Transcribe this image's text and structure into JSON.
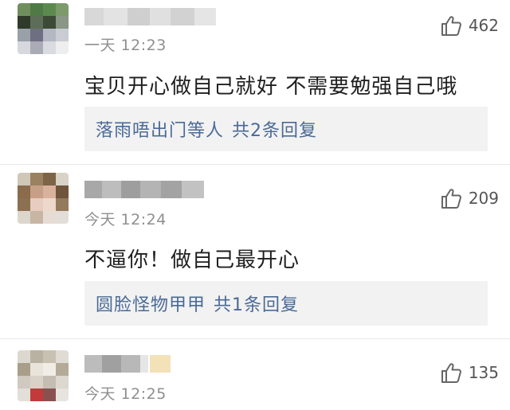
{
  "comments": [
    {
      "time": "一天 12:23",
      "likes": "462",
      "content": "宝贝开心做自己就好 不需要勉强自己哦",
      "reply_user": "落雨唔出门等人",
      "reply_count": "共2条回复"
    },
    {
      "time": "今天 12:24",
      "likes": "209",
      "content": "不逼你！做自己最开心",
      "reply_user": "圆脸怪物甲甲",
      "reply_count": "共1条回复"
    },
    {
      "time": "今天 12:25",
      "likes": "135"
    }
  ],
  "colors": {
    "reply_link": "#4a6a96",
    "timestamp": "#8f8f8f",
    "reply_bg": "#f2f2f2"
  },
  "icons": {
    "like": "thumbs-up-icon"
  }
}
